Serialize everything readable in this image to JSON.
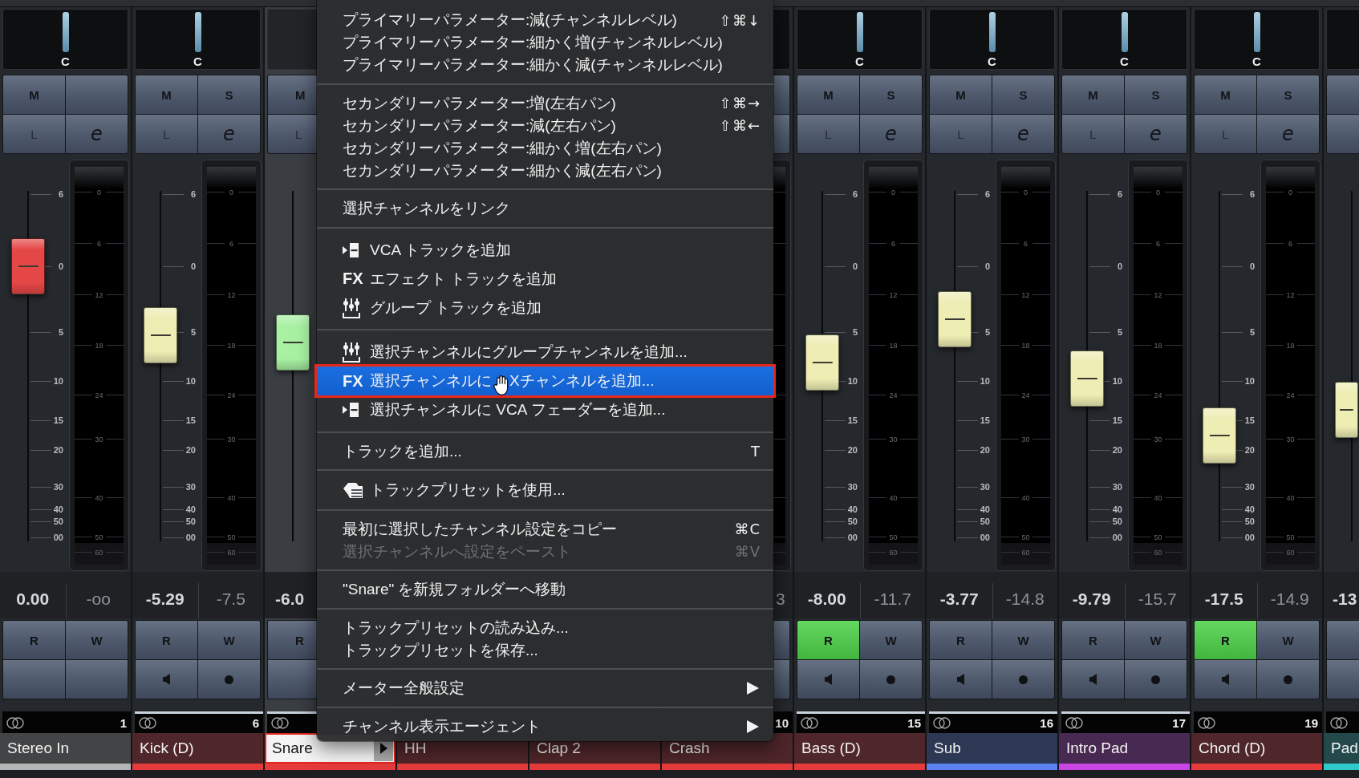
{
  "mixer": {
    "strips": [
      {
        "kind": "full",
        "name": "Stereo In",
        "number": "1",
        "color": "#b5b5b5",
        "selected": false,
        "focused": false,
        "pan": "C",
        "top_buttons": [
          {
            "kind": "label",
            "label": "M",
            "on": false
          },
          {
            "kind": "blank",
            "on": false
          },
          {
            "kind": "dim",
            "label": "L",
            "on": false
          },
          {
            "kind": "edit",
            "label": "e",
            "on": false
          }
        ],
        "scale": [
          "6",
          "0",
          "5",
          "10",
          "15",
          "20",
          "30",
          "40",
          "50",
          "00"
        ],
        "meter_scale": [
          "0",
          "6",
          "12",
          "18",
          "24",
          "30",
          "40",
          "50",
          "60"
        ],
        "fader": {
          "color": "#e54646",
          "level": 0.773
        },
        "volume": "0.00",
        "peak": "-oo",
        "bottom_buttons": [
          {
            "kind": "label",
            "label": "R",
            "on": false
          },
          {
            "kind": "label",
            "label": "W",
            "on": false
          },
          {
            "kind": "blank",
            "on": false
          },
          {
            "kind": "blank",
            "on": false
          }
        ]
      },
      {
        "kind": "full",
        "name": "Kick (D)",
        "number": "6",
        "color": "#e53b3b",
        "selected": true,
        "focused": false,
        "pan": "C",
        "top_buttons": [
          {
            "kind": "label",
            "label": "M",
            "on": false
          },
          {
            "kind": "label",
            "label": "S",
            "on": false
          },
          {
            "kind": "dim",
            "label": "L",
            "on": false
          },
          {
            "kind": "edit",
            "label": "e",
            "on": false
          }
        ],
        "scale": [
          "6",
          "0",
          "5",
          "10",
          "15",
          "20",
          "30",
          "40",
          "50",
          "00"
        ],
        "meter_scale": [
          "0",
          "6",
          "12",
          "18",
          "24",
          "30",
          "40",
          "50",
          "60"
        ],
        "fader": {
          "color": "#eeedb4",
          "level": 0.577
        },
        "volume": "-5.29",
        "peak": "-7.5",
        "bottom_buttons": [
          {
            "kind": "label",
            "label": "R",
            "on": false
          },
          {
            "kind": "label",
            "label": "W",
            "on": false
          },
          {
            "kind": "monitor",
            "on": false
          },
          {
            "kind": "record",
            "on": false
          }
        ]
      },
      {
        "kind": "menu_left",
        "name": "Snare",
        "color": "#e53b3b",
        "selected": true,
        "focused": true,
        "top_buttons": [
          {
            "kind": "label",
            "label": "M",
            "on": false
          },
          {
            "kind": "dim",
            "label": "L",
            "on": false
          }
        ],
        "fader": {
          "color": "#a8f0a2",
          "level": 0.557
        },
        "volume": "-6.0",
        "bottom_buttons": [
          {
            "kind": "label",
            "label": "R",
            "on": false
          },
          {
            "kind": "blank",
            "on": false
          }
        ]
      },
      {
        "kind": "menu_hidden",
        "name": "HH",
        "color": "#e53b3b",
        "focused": false
      },
      {
        "kind": "menu_hidden",
        "name": "Clap 2",
        "color": "#e53b3b",
        "focused": false
      },
      {
        "kind": "menu_right",
        "name": "Crash",
        "number": "10",
        "color": "#e53b3b",
        "selected": false,
        "focused": false,
        "top_buttons": [
          {
            "kind": "blank",
            "on": false
          },
          {
            "kind": "blank",
            "on": false
          }
        ],
        "peak": "3",
        "bottom_buttons": [
          {
            "kind": "blank",
            "on": false
          },
          {
            "kind": "blank",
            "on": false
          }
        ]
      },
      {
        "kind": "full",
        "name": "Bass (D)",
        "number": "15",
        "color": "#e53b3b",
        "selected": true,
        "focused": false,
        "pan": "C",
        "top_buttons": [
          {
            "kind": "label",
            "label": "M",
            "on": false
          },
          {
            "kind": "label",
            "label": "S",
            "on": false
          },
          {
            "kind": "dim",
            "label": "L",
            "on": false
          },
          {
            "kind": "edit",
            "label": "e",
            "on": false
          }
        ],
        "scale": [
          "6",
          "0",
          "5",
          "10",
          "15",
          "20",
          "30",
          "40",
          "50",
          "00"
        ],
        "meter_scale": [
          "0",
          "6",
          "12",
          "18",
          "24",
          "30",
          "40",
          "50",
          "60"
        ],
        "fader": {
          "color": "#eeedb4",
          "level": 0.5
        },
        "volume": "-8.00",
        "peak": "-11.7",
        "bottom_buttons": [
          {
            "kind": "label",
            "label": "R",
            "on": true
          },
          {
            "kind": "label",
            "label": "W",
            "on": false
          },
          {
            "kind": "monitor",
            "on": false
          },
          {
            "kind": "record",
            "on": false
          }
        ]
      },
      {
        "kind": "full",
        "name": "Sub",
        "number": "16",
        "color": "#5b82f0",
        "selected": true,
        "focused": false,
        "pan": "C",
        "top_buttons": [
          {
            "kind": "label",
            "label": "M",
            "on": false
          },
          {
            "kind": "label",
            "label": "S",
            "on": false
          },
          {
            "kind": "dim",
            "label": "L",
            "on": false
          },
          {
            "kind": "edit",
            "label": "e",
            "on": false
          }
        ],
        "scale": [
          "6",
          "0",
          "5",
          "10",
          "15",
          "20",
          "30",
          "40",
          "50",
          "00"
        ],
        "meter_scale": [
          "0",
          "6",
          "12",
          "18",
          "24",
          "30",
          "40",
          "50",
          "60"
        ],
        "fader": {
          "color": "#eeedb4",
          "level": 0.623
        },
        "volume": "-3.77",
        "peak": "-14.8",
        "bottom_buttons": [
          {
            "kind": "label",
            "label": "R",
            "on": false
          },
          {
            "kind": "label",
            "label": "W",
            "on": false
          },
          {
            "kind": "monitor",
            "on": false
          },
          {
            "kind": "record",
            "on": false
          }
        ]
      },
      {
        "kind": "full",
        "name": "Intro Pad",
        "number": "17",
        "color": "#c946e4",
        "selected": true,
        "focused": false,
        "pan": "C",
        "top_buttons": [
          {
            "kind": "label",
            "label": "M",
            "on": false
          },
          {
            "kind": "label",
            "label": "S",
            "on": false
          },
          {
            "kind": "dim",
            "label": "L",
            "on": false
          },
          {
            "kind": "edit",
            "label": "e",
            "on": false
          }
        ],
        "scale": [
          "6",
          "0",
          "5",
          "10",
          "15",
          "20",
          "30",
          "40",
          "50",
          "00"
        ],
        "meter_scale": [
          "0",
          "6",
          "12",
          "18",
          "24",
          "30",
          "40",
          "50",
          "60"
        ],
        "fader": {
          "color": "#eeedb4",
          "level": 0.455
        },
        "volume": "-9.79",
        "peak": "-15.7",
        "bottom_buttons": [
          {
            "kind": "label",
            "label": "R",
            "on": false
          },
          {
            "kind": "label",
            "label": "W",
            "on": false
          },
          {
            "kind": "monitor",
            "on": false
          },
          {
            "kind": "record",
            "on": false
          }
        ]
      },
      {
        "kind": "full",
        "name": "Chord (D)",
        "number": "19",
        "color": "#e53b3b",
        "selected": false,
        "focused": false,
        "pan": "C",
        "top_buttons": [
          {
            "kind": "label",
            "label": "M",
            "on": false
          },
          {
            "kind": "label",
            "label": "S",
            "on": false
          },
          {
            "kind": "dim",
            "label": "L",
            "on": false
          },
          {
            "kind": "edit",
            "label": "e",
            "on": false
          }
        ],
        "scale": [
          "6",
          "0",
          "5",
          "10",
          "15",
          "20",
          "30",
          "40",
          "50",
          "00"
        ],
        "meter_scale": [
          "0",
          "6",
          "12",
          "18",
          "24",
          "30",
          "40",
          "50",
          "60"
        ],
        "fader": {
          "color": "#eeedb4",
          "level": 0.293
        },
        "volume": "-17.5",
        "peak": "-14.9",
        "bottom_buttons": [
          {
            "kind": "label",
            "label": "R",
            "on": true
          },
          {
            "kind": "label",
            "label": "W",
            "on": false
          },
          {
            "kind": "monitor",
            "on": false
          },
          {
            "kind": "record",
            "on": false
          }
        ]
      },
      {
        "kind": "edge",
        "name": "Pad",
        "color": "#2fcbcb",
        "selected": false,
        "focused": false,
        "top_buttons": [
          {
            "kind": "blank",
            "on": false
          },
          {
            "kind": "blank",
            "on": false
          }
        ],
        "fader": {
          "color": "#eeedb4",
          "level": 0.366
        },
        "volume": "-13",
        "bottom_buttons": [
          {
            "kind": "blank",
            "on": false
          },
          {
            "kind": "blank",
            "on": false
          }
        ]
      }
    ]
  },
  "context_menu": {
    "groups": [
      [
        {
          "kind": "plain",
          "label": "プライマリーパラメーター:減(チャンネルレベル)",
          "shortcut": "⇧⌘↓",
          "selected": false,
          "disabled": false,
          "submenu": false
        },
        {
          "kind": "plain",
          "label": "プライマリーパラメーター:細かく増(チャンネルレベル)",
          "selected": false,
          "disabled": false,
          "submenu": false
        },
        {
          "kind": "plain",
          "label": "プライマリーパラメーター:細かく減(チャンネルレベル)",
          "selected": false,
          "disabled": false,
          "submenu": false
        }
      ],
      [
        {
          "kind": "plain",
          "label": "セカンダリーパラメーター:増(左右パン)",
          "shortcut": "⇧⌘→",
          "selected": false,
          "disabled": false,
          "submenu": false
        },
        {
          "kind": "plain",
          "label": "セカンダリーパラメーター:減(左右パン)",
          "shortcut": "⇧⌘←",
          "selected": false,
          "disabled": false,
          "submenu": false
        },
        {
          "kind": "plain",
          "label": "セカンダリーパラメーター:細かく増(左右パン)",
          "selected": false,
          "disabled": false,
          "submenu": false
        },
        {
          "kind": "plain",
          "label": "セカンダリーパラメーター:細かく減(左右パン)",
          "selected": false,
          "disabled": false,
          "submenu": false
        }
      ],
      [
        {
          "kind": "plain",
          "label": "選択チャンネルをリンク",
          "selected": false,
          "disabled": false,
          "submenu": false
        }
      ],
      [
        {
          "kind": "vca",
          "label": "VCA トラックを追加",
          "selected": false,
          "disabled": false,
          "submenu": false
        },
        {
          "kind": "fx",
          "badge": "FX",
          "label": "エフェクト トラックを追加",
          "selected": false,
          "disabled": false,
          "submenu": false
        },
        {
          "kind": "group",
          "label": "グループ トラックを追加",
          "selected": false,
          "disabled": false,
          "submenu": false
        }
      ],
      [
        {
          "kind": "group",
          "label": "選択チャンネルにグループチャンネルを追加...",
          "selected": false,
          "disabled": false,
          "submenu": false
        },
        {
          "kind": "fx",
          "badge": "FX",
          "label_parts": [
            "選択チャンネルに",
            "Xチャンネルを追加..."
          ],
          "selected": true,
          "disabled": false,
          "submenu": false
        },
        {
          "kind": "vca",
          "label": "選択チャンネルに VCA フェーダーを追加...",
          "selected": false,
          "disabled": false,
          "submenu": false
        }
      ],
      [
        {
          "kind": "plain",
          "label": "トラックを追加...",
          "shortcut": "T",
          "selected": false,
          "disabled": false,
          "submenu": false
        }
      ],
      [
        {
          "kind": "preset",
          "label": "トラックプリセットを使用...",
          "selected": false,
          "disabled": false,
          "submenu": false
        }
      ],
      [
        {
          "kind": "plain",
          "label": "最初に選択したチャンネル設定をコピー",
          "shortcut": "⌘C",
          "selected": false,
          "disabled": false,
          "submenu": false
        },
        {
          "kind": "plain",
          "label": "選択チャンネルへ設定をペースト",
          "shortcut": "⌘V",
          "selected": false,
          "disabled": true,
          "submenu": false
        }
      ],
      [
        {
          "kind": "plain",
          "label": "\"Snare\" を新規フォルダーへ移動",
          "selected": false,
          "disabled": false,
          "submenu": false
        }
      ],
      [
        {
          "kind": "plain",
          "label": "トラックプリセットの読み込み...",
          "selected": false,
          "disabled": false,
          "submenu": false
        },
        {
          "kind": "plain",
          "label": "トラックプリセットを保存...",
          "selected": false,
          "disabled": false,
          "submenu": false
        }
      ],
      [
        {
          "kind": "plain",
          "label": "メーター全般設定",
          "selected": false,
          "disabled": false,
          "submenu": true
        }
      ],
      [
        {
          "kind": "plain",
          "label": "チャンネル表示エージェント",
          "selected": false,
          "disabled": false,
          "submenu": true
        }
      ]
    ]
  }
}
